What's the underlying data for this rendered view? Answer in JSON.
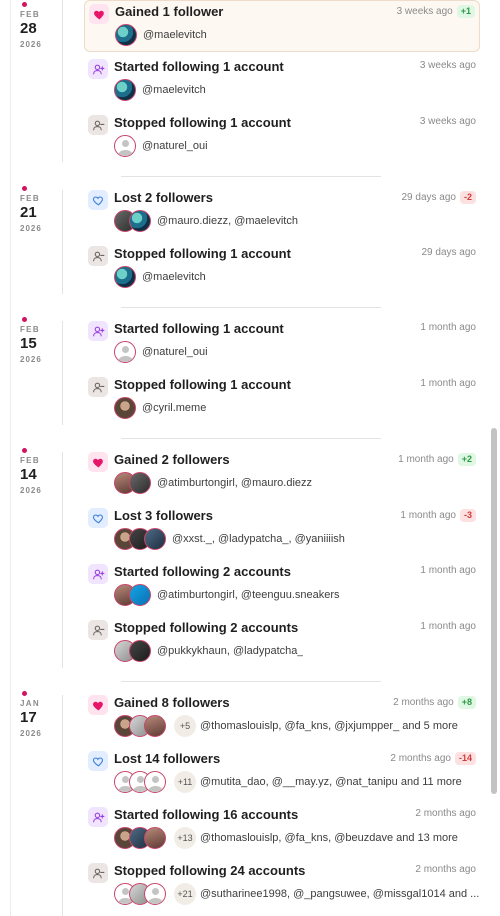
{
  "groups": [
    {
      "month": "FEB",
      "day": "28",
      "year": "2026",
      "events": [
        {
          "title": "Gained 1 follower",
          "time": "3 weeks ago",
          "badge": "+1",
          "users_text": "@maelevitch"
        },
        {
          "title": "Started following 1 account",
          "time": "3 weeks ago",
          "badge": "",
          "users_text": "@maelevitch"
        },
        {
          "title": "Stopped following 1 account",
          "time": "3 weeks ago",
          "badge": "",
          "users_text": "@naturel_oui"
        }
      ]
    },
    {
      "month": "FEB",
      "day": "21",
      "year": "2026",
      "events": [
        {
          "title": "Lost 2 followers",
          "time": "29 days ago",
          "badge": "-2",
          "users_text": "@mauro.diezz, @maelevitch"
        },
        {
          "title": "Stopped following 1 account",
          "time": "29 days ago",
          "badge": "",
          "users_text": "@maelevitch"
        }
      ]
    },
    {
      "month": "FEB",
      "day": "15",
      "year": "2026",
      "events": [
        {
          "title": "Started following 1 account",
          "time": "1 month ago",
          "badge": "",
          "users_text": "@naturel_oui"
        },
        {
          "title": "Stopped following 1 account",
          "time": "1 month ago",
          "badge": "",
          "users_text": "@cyril.meme"
        }
      ]
    },
    {
      "month": "FEB",
      "day": "14",
      "year": "2026",
      "events": [
        {
          "title": "Gained 2 followers",
          "time": "1 month ago",
          "badge": "+2",
          "users_text": "@atimburtongirl, @mauro.diezz"
        },
        {
          "title": "Lost 3 followers",
          "time": "1 month ago",
          "badge": "-3",
          "users_text": "@xxst._, @ladypatcha_, @yaniiiish"
        },
        {
          "title": "Started following 2 accounts",
          "time": "1 month ago",
          "badge": "",
          "users_text": "@atimburtongirl, @teenguu.sneakers"
        },
        {
          "title": "Stopped following 2 accounts",
          "time": "1 month ago",
          "badge": "",
          "users_text": "@pukkykhaun, @ladypatcha_"
        }
      ]
    },
    {
      "month": "JAN",
      "day": "17",
      "year": "2026",
      "events": [
        {
          "title": "Gained 8 followers",
          "time": "2 months ago",
          "badge": "+8",
          "more": "+5",
          "users_text": "@thomaslouislp, @fa_kns, @jxjumpper_ and 5 more"
        },
        {
          "title": "Lost 14 followers",
          "time": "2 months ago",
          "badge": "-14",
          "more": "+11",
          "users_text": "@mutita_dao, @__may.yz, @nat_tanipu and 11 more"
        },
        {
          "title": "Started following 16 accounts",
          "time": "2 months ago",
          "badge": "",
          "more": "+13",
          "users_text": "@thomaslouislp, @fa_kns, @beuzdave and 13 more"
        },
        {
          "title": "Stopped following 24 accounts",
          "time": "2 months ago",
          "badge": "",
          "more": "+21",
          "users_text": "@sutharinee1998, @_pangsuwee, @missgal1014 and ..."
        }
      ]
    }
  ],
  "icons": {
    "gain": "heart-icon",
    "lost": "heart-outline-icon",
    "follow": "user-plus-icon",
    "unfollow": "user-minus-icon"
  },
  "colors": {
    "accent": "#d0145f",
    "positive": "#2b9a45",
    "negative": "#d23a3a"
  }
}
